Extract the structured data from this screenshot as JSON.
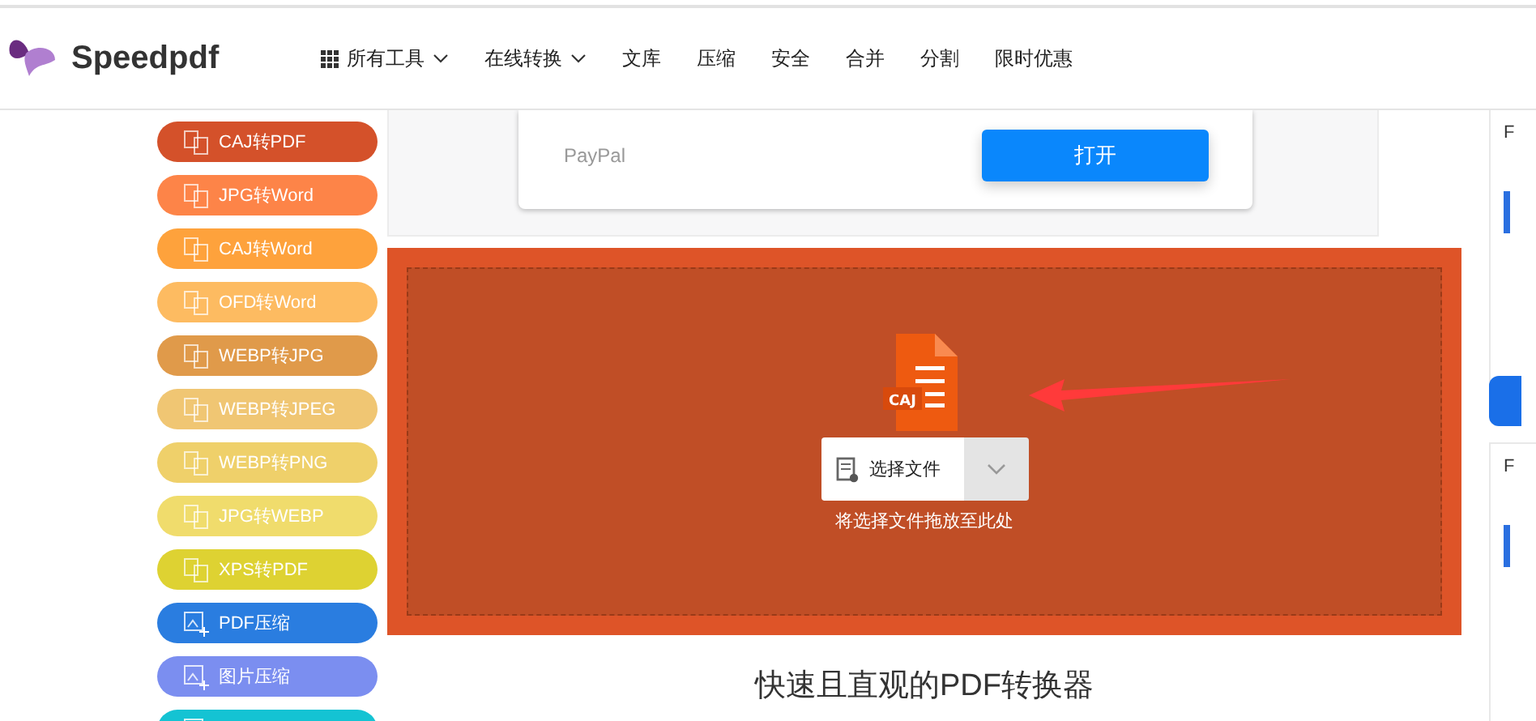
{
  "header": {
    "brand": "Speedpdf",
    "nav": [
      {
        "label": "所有工具",
        "grid": true,
        "dropdown": true
      },
      {
        "label": "在线转换",
        "grid": false,
        "dropdown": true
      },
      {
        "label": "文库",
        "grid": false,
        "dropdown": false
      },
      {
        "label": "压缩",
        "grid": false,
        "dropdown": false
      },
      {
        "label": "安全",
        "grid": false,
        "dropdown": false
      },
      {
        "label": "合并",
        "grid": false,
        "dropdown": false
      },
      {
        "label": "分割",
        "grid": false,
        "dropdown": false
      },
      {
        "label": "限时优惠",
        "grid": false,
        "dropdown": false
      }
    ]
  },
  "sidebar": {
    "items": [
      {
        "label": "CAJ转PDF",
        "color": "#d4512a",
        "kind": "convert"
      },
      {
        "label": "JPG转Word",
        "color": "#fd8448",
        "kind": "convert"
      },
      {
        "label": "CAJ转Word",
        "color": "#fea23c",
        "kind": "convert"
      },
      {
        "label": "OFD转Word",
        "color": "#fdbb61",
        "kind": "convert"
      },
      {
        "label": "WEBP转JPG",
        "color": "#e09a4a",
        "kind": "convert"
      },
      {
        "label": "WEBP转JPEG",
        "color": "#f0c673",
        "kind": "convert"
      },
      {
        "label": "WEBP转PNG",
        "color": "#efd06a",
        "kind": "convert"
      },
      {
        "label": "JPG转WEBP",
        "color": "#f0dc6c",
        "kind": "convert"
      },
      {
        "label": "XPS转PDF",
        "color": "#ded232",
        "kind": "convert"
      },
      {
        "label": "PDF压缩",
        "color": "#2a7de0",
        "kind": "compress"
      },
      {
        "label": "图片压缩",
        "color": "#7b8ef0",
        "kind": "compress"
      },
      {
        "color": "#14c3d3",
        "kind": "compress"
      }
    ]
  },
  "payment": {
    "method": "PayPal",
    "button": "打开"
  },
  "upload": {
    "file_badge": "CAJ",
    "select_button": "选择文件",
    "hint": "将选择文件拖放至此处"
  },
  "heading": "快速且直观的PDF转换器",
  "side_cards": [
    {
      "letter": "F"
    },
    {
      "letter": "F"
    }
  ]
}
